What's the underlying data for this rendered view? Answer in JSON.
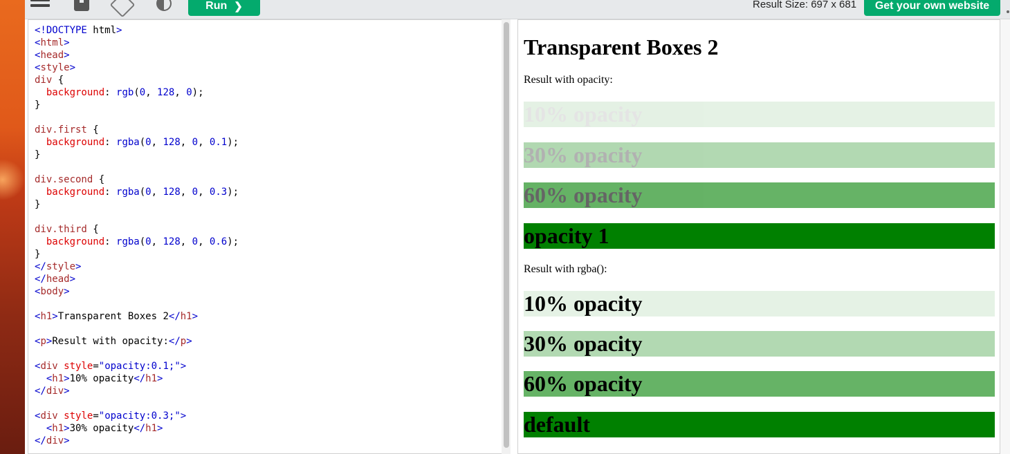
{
  "toolbar": {
    "run_label": "Run",
    "run_arrow": "❯",
    "result_size": "Result Size: 697 x 681",
    "own_website_label": "Get your own website"
  },
  "editor": {
    "lines": [
      [
        [
          "br",
          "<!DOCTYPE "
        ],
        [
          "txt",
          "html"
        ],
        [
          "br",
          ">"
        ]
      ],
      [
        [
          "br",
          "<"
        ],
        [
          "tag",
          "html"
        ],
        [
          "br",
          ">"
        ]
      ],
      [
        [
          "br",
          "<"
        ],
        [
          "tag",
          "head"
        ],
        [
          "br",
          ">"
        ]
      ],
      [
        [
          "br",
          "<"
        ],
        [
          "tag",
          "style"
        ],
        [
          "br",
          ">"
        ]
      ],
      [
        [
          "sel",
          "div"
        ],
        [
          "txt",
          " {"
        ]
      ],
      [
        [
          "txt",
          "  "
        ],
        [
          "prop",
          "background"
        ],
        [
          "txt",
          ": "
        ],
        [
          "val",
          "rgb"
        ],
        [
          "txt",
          "("
        ],
        [
          "num",
          "0"
        ],
        [
          "txt",
          ", "
        ],
        [
          "num",
          "128"
        ],
        [
          "txt",
          ", "
        ],
        [
          "num",
          "0"
        ],
        [
          "txt",
          ");"
        ]
      ],
      [
        [
          "txt",
          "}"
        ]
      ],
      [
        [
          "txt",
          ""
        ]
      ],
      [
        [
          "sel",
          "div.first"
        ],
        [
          "txt",
          " {"
        ]
      ],
      [
        [
          "txt",
          "  "
        ],
        [
          "prop",
          "background"
        ],
        [
          "txt",
          ": "
        ],
        [
          "val",
          "rgba"
        ],
        [
          "txt",
          "("
        ],
        [
          "num",
          "0"
        ],
        [
          "txt",
          ", "
        ],
        [
          "num",
          "128"
        ],
        [
          "txt",
          ", "
        ],
        [
          "num",
          "0"
        ],
        [
          "txt",
          ", "
        ],
        [
          "num",
          "0.1"
        ],
        [
          "txt",
          ");"
        ]
      ],
      [
        [
          "txt",
          "}"
        ]
      ],
      [
        [
          "txt",
          ""
        ]
      ],
      [
        [
          "sel",
          "div.second"
        ],
        [
          "txt",
          " {"
        ]
      ],
      [
        [
          "txt",
          "  "
        ],
        [
          "prop",
          "background"
        ],
        [
          "txt",
          ": "
        ],
        [
          "val",
          "rgba"
        ],
        [
          "txt",
          "("
        ],
        [
          "num",
          "0"
        ],
        [
          "txt",
          ", "
        ],
        [
          "num",
          "128"
        ],
        [
          "txt",
          ", "
        ],
        [
          "num",
          "0"
        ],
        [
          "txt",
          ", "
        ],
        [
          "num",
          "0.3"
        ],
        [
          "txt",
          ");"
        ]
      ],
      [
        [
          "txt",
          "}"
        ]
      ],
      [
        [
          "txt",
          ""
        ]
      ],
      [
        [
          "sel",
          "div.third"
        ],
        [
          "txt",
          " {"
        ]
      ],
      [
        [
          "txt",
          "  "
        ],
        [
          "prop",
          "background"
        ],
        [
          "txt",
          ": "
        ],
        [
          "val",
          "rgba"
        ],
        [
          "txt",
          "("
        ],
        [
          "num",
          "0"
        ],
        [
          "txt",
          ", "
        ],
        [
          "num",
          "128"
        ],
        [
          "txt",
          ", "
        ],
        [
          "num",
          "0"
        ],
        [
          "txt",
          ", "
        ],
        [
          "num",
          "0.6"
        ],
        [
          "txt",
          ");"
        ]
      ],
      [
        [
          "txt",
          "}"
        ]
      ],
      [
        [
          "br",
          "</"
        ],
        [
          "tag",
          "style"
        ],
        [
          "br",
          ">"
        ]
      ],
      [
        [
          "br",
          "</"
        ],
        [
          "tag",
          "head"
        ],
        [
          "br",
          ">"
        ]
      ],
      [
        [
          "br",
          "<"
        ],
        [
          "tag",
          "body"
        ],
        [
          "br",
          ">"
        ]
      ],
      [
        [
          "txt",
          ""
        ]
      ],
      [
        [
          "br",
          "<"
        ],
        [
          "tag",
          "h1"
        ],
        [
          "br",
          ">"
        ],
        [
          "txt",
          "Transparent Boxes 2"
        ],
        [
          "br",
          "</"
        ],
        [
          "tag",
          "h1"
        ],
        [
          "br",
          ">"
        ]
      ],
      [
        [
          "txt",
          ""
        ]
      ],
      [
        [
          "br",
          "<"
        ],
        [
          "tag",
          "p"
        ],
        [
          "br",
          ">"
        ],
        [
          "txt",
          "Result with opacity:"
        ],
        [
          "br",
          "</"
        ],
        [
          "tag",
          "p"
        ],
        [
          "br",
          ">"
        ]
      ],
      [
        [
          "txt",
          ""
        ]
      ],
      [
        [
          "br",
          "<"
        ],
        [
          "tag",
          "div"
        ],
        [
          "txt",
          " "
        ],
        [
          "attr",
          "style"
        ],
        [
          "txt",
          "="
        ],
        [
          "val",
          "\"opacity:0.1;\""
        ],
        [
          "br",
          ">"
        ]
      ],
      [
        [
          "txt",
          "  "
        ],
        [
          "br",
          "<"
        ],
        [
          "tag",
          "h1"
        ],
        [
          "br",
          ">"
        ],
        [
          "txt",
          "10% opacity"
        ],
        [
          "br",
          "</"
        ],
        [
          "tag",
          "h1"
        ],
        [
          "br",
          ">"
        ]
      ],
      [
        [
          "br",
          "</"
        ],
        [
          "tag",
          "div"
        ],
        [
          "br",
          ">"
        ]
      ],
      [
        [
          "txt",
          ""
        ]
      ],
      [
        [
          "br",
          "<"
        ],
        [
          "tag",
          "div"
        ],
        [
          "txt",
          " "
        ],
        [
          "attr",
          "style"
        ],
        [
          "txt",
          "="
        ],
        [
          "val",
          "\"opacity:0.3;\""
        ],
        [
          "br",
          ">"
        ]
      ],
      [
        [
          "txt",
          "  "
        ],
        [
          "br",
          "<"
        ],
        [
          "tag",
          "h1"
        ],
        [
          "br",
          ">"
        ],
        [
          "txt",
          "30% opacity"
        ],
        [
          "br",
          "</"
        ],
        [
          "tag",
          "h1"
        ],
        [
          "br",
          ">"
        ]
      ],
      [
        [
          "br",
          "</"
        ],
        [
          "tag",
          "div"
        ],
        [
          "br",
          ">"
        ]
      ]
    ]
  },
  "result": {
    "title": "Transparent Boxes 2",
    "opacity_label": "Result with opacity:",
    "opacity_boxes": [
      {
        "text": "10% opacity",
        "opacity": 0.1
      },
      {
        "text": "30% opacity",
        "opacity": 0.3
      },
      {
        "text": "60% opacity",
        "opacity": 0.6
      },
      {
        "text": "opacity 1",
        "opacity": 1
      }
    ],
    "rgba_label": "Result with rgba():",
    "rgba_boxes": [
      {
        "text": "10% opacity",
        "alpha": 0.1
      },
      {
        "text": "30% opacity",
        "alpha": 0.3
      },
      {
        "text": "60% opacity",
        "alpha": 0.6
      },
      {
        "text": "default",
        "alpha": 1
      }
    ]
  }
}
